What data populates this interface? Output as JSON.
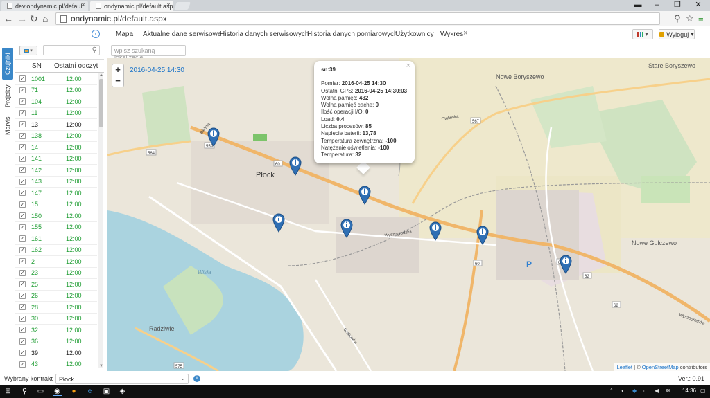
{
  "browser": {
    "tabs": [
      {
        "title": "dev.ondynamic.pl/default."
      },
      {
        "title": "ondynamic.pl/default.aspx"
      }
    ],
    "url": "ondynamic.pl/default.aspx"
  },
  "menu": {
    "items": [
      "Mapa",
      "Aktualne dane serwisowe",
      "Historia danych serwisowych",
      "Historia danych pomiarowych",
      "Użytkownicy",
      "Wykres"
    ],
    "close_symbol": "×",
    "logout_label": "Wyloguj"
  },
  "side_tabs": [
    "Czujniki",
    "Projekty",
    "Marvis"
  ],
  "sensor_table": {
    "headers": {
      "sn": "SN",
      "last": "Ostatni odczyt"
    },
    "rows": [
      {
        "sn": "1001",
        "time": "12:00",
        "green": true
      },
      {
        "sn": "71",
        "time": "12:00",
        "green": true
      },
      {
        "sn": "104",
        "time": "12:00",
        "green": true
      },
      {
        "sn": "11",
        "time": "12:00",
        "green": true
      },
      {
        "sn": "13",
        "time": "12:00",
        "green": false
      },
      {
        "sn": "138",
        "time": "12:00",
        "green": true
      },
      {
        "sn": "14",
        "time": "12:00",
        "green": true
      },
      {
        "sn": "141",
        "time": "12:00",
        "green": true
      },
      {
        "sn": "142",
        "time": "12:00",
        "green": true
      },
      {
        "sn": "143",
        "time": "12:00",
        "green": true
      },
      {
        "sn": "147",
        "time": "12:00",
        "green": true
      },
      {
        "sn": "15",
        "time": "12:00",
        "green": true
      },
      {
        "sn": "150",
        "time": "12:00",
        "green": true
      },
      {
        "sn": "155",
        "time": "12:00",
        "green": true
      },
      {
        "sn": "161",
        "time": "12:00",
        "green": true
      },
      {
        "sn": "162",
        "time": "12:00",
        "green": true
      },
      {
        "sn": "2",
        "time": "12:00",
        "green": true
      },
      {
        "sn": "23",
        "time": "12:00",
        "green": true
      },
      {
        "sn": "25",
        "time": "12:00",
        "green": true
      },
      {
        "sn": "26",
        "time": "12:00",
        "green": true
      },
      {
        "sn": "28",
        "time": "12:00",
        "green": true
      },
      {
        "sn": "30",
        "time": "12:00",
        "green": true
      },
      {
        "sn": "32",
        "time": "12:00",
        "green": true
      },
      {
        "sn": "36",
        "time": "12:00",
        "green": true
      },
      {
        "sn": "39",
        "time": "12:00",
        "green": false
      },
      {
        "sn": "43",
        "time": "12:00",
        "green": true
      }
    ]
  },
  "location_search": {
    "placeholder": "wpisz szukaną lokalizację"
  },
  "map": {
    "date_label": "2016-04-25 14:30",
    "zoom_in": "+",
    "zoom_out": "−",
    "labels": {
      "plock": "Płock",
      "stare_boryszewo": "Stare Boryszewo",
      "nowe_boryszewo": "Nowe Boryszewo",
      "nowe_gulczewo": "Nowe Gulczewo",
      "radziwie": "Radziwie",
      "wisla": "Wisła",
      "parking": "P"
    },
    "road_numbers": [
      "559",
      "564",
      "60",
      "60",
      "62",
      "62",
      "62",
      "567",
      "575"
    ],
    "street_names": [
      "Wyszogrodzka",
      "Otolińska",
      "Bielska",
      "Grabówka",
      "Wyszogrodzka"
    ],
    "attribution": {
      "leaflet": "Leaflet",
      "sep": " | © ",
      "osm": "OpenStreetMap",
      "contributors": " contributors"
    }
  },
  "popup": {
    "title": "sn:39",
    "close": "×",
    "lines": [
      {
        "label": "Pomiar: ",
        "value": "2016-04-25 14:30"
      },
      {
        "label": "Ostatni GPS: ",
        "value": "2016-04-25 14:30:03"
      },
      {
        "label": "Wolna pamięć: ",
        "value": "432"
      },
      {
        "label": "Wolna pamięć cache: ",
        "value": "0"
      },
      {
        "label": "Ilość operacji I/O: ",
        "value": "0"
      },
      {
        "label": "Load: ",
        "value": "0.4"
      },
      {
        "label": "Liczba procesów: ",
        "value": "85"
      },
      {
        "label": "Napięcie baterii: ",
        "value": "13,78"
      },
      {
        "label": "Temperatura zewnętrzna: ",
        "value": "-100"
      },
      {
        "label": "Natężenie oświetlenia: ",
        "value": "-100"
      },
      {
        "label": "Temperatura: ",
        "value": "32"
      }
    ]
  },
  "footer": {
    "contract_label": "Wybrany kontrakt",
    "contract_value": "Płock",
    "version": "Ver.: 0.91"
  },
  "taskbar": {
    "clock": "14:36"
  },
  "colors": {
    "accent": "#3a87c8",
    "green_time": "#1f9d33",
    "marker": "#2f6fb4"
  }
}
